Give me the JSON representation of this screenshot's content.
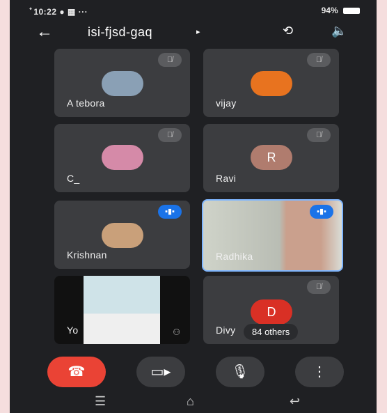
{
  "status_bar": {
    "left_text": "᪳ 10:22 ● ▦ ···",
    "right_text": "94%"
  },
  "header": {
    "back_icon": "arrow-left-icon",
    "meeting_code": "isi-fjsd-gaq",
    "caret": "▸",
    "camera_switch_icon": "camera-switch-icon",
    "speaker_icon": "speaker-icon"
  },
  "participants": [
    {
      "name": "A tebora",
      "status": "muted",
      "avatar_color": "#8aa0b5"
    },
    {
      "name": "vijay",
      "status": "muted",
      "avatar_color": "#e8731f"
    },
    {
      "name": "C_",
      "status": "muted",
      "avatar_color": "#d58aa8"
    },
    {
      "name": "Ravi",
      "status": "muted",
      "avatar_letter": "R",
      "avatar_color": "#b07c6e"
    },
    {
      "name": "Krishnan",
      "status": "speaking",
      "avatar_color": "#c9a07a"
    },
    {
      "name": "Radhika",
      "status": "speaking",
      "video": true,
      "highlight": "#7fb6ff"
    },
    {
      "name": "Yo",
      "status": "video",
      "video": true
    },
    {
      "name": "Divy",
      "status": "muted",
      "avatar_letter": "D",
      "avatar_color": "#d93025"
    }
  ],
  "others_badge": "84 others",
  "controls": {
    "end_call_icon": "end-call-icon",
    "camera_icon": "video-camera-icon",
    "mic_icon": "mic-icon",
    "more_icon": "more-vertical-icon",
    "end_call_color": "#ea4335"
  },
  "nav": {
    "recent_icon": "recent-apps-icon",
    "home_icon": "home-icon",
    "back_icon": "back-nav-icon"
  }
}
